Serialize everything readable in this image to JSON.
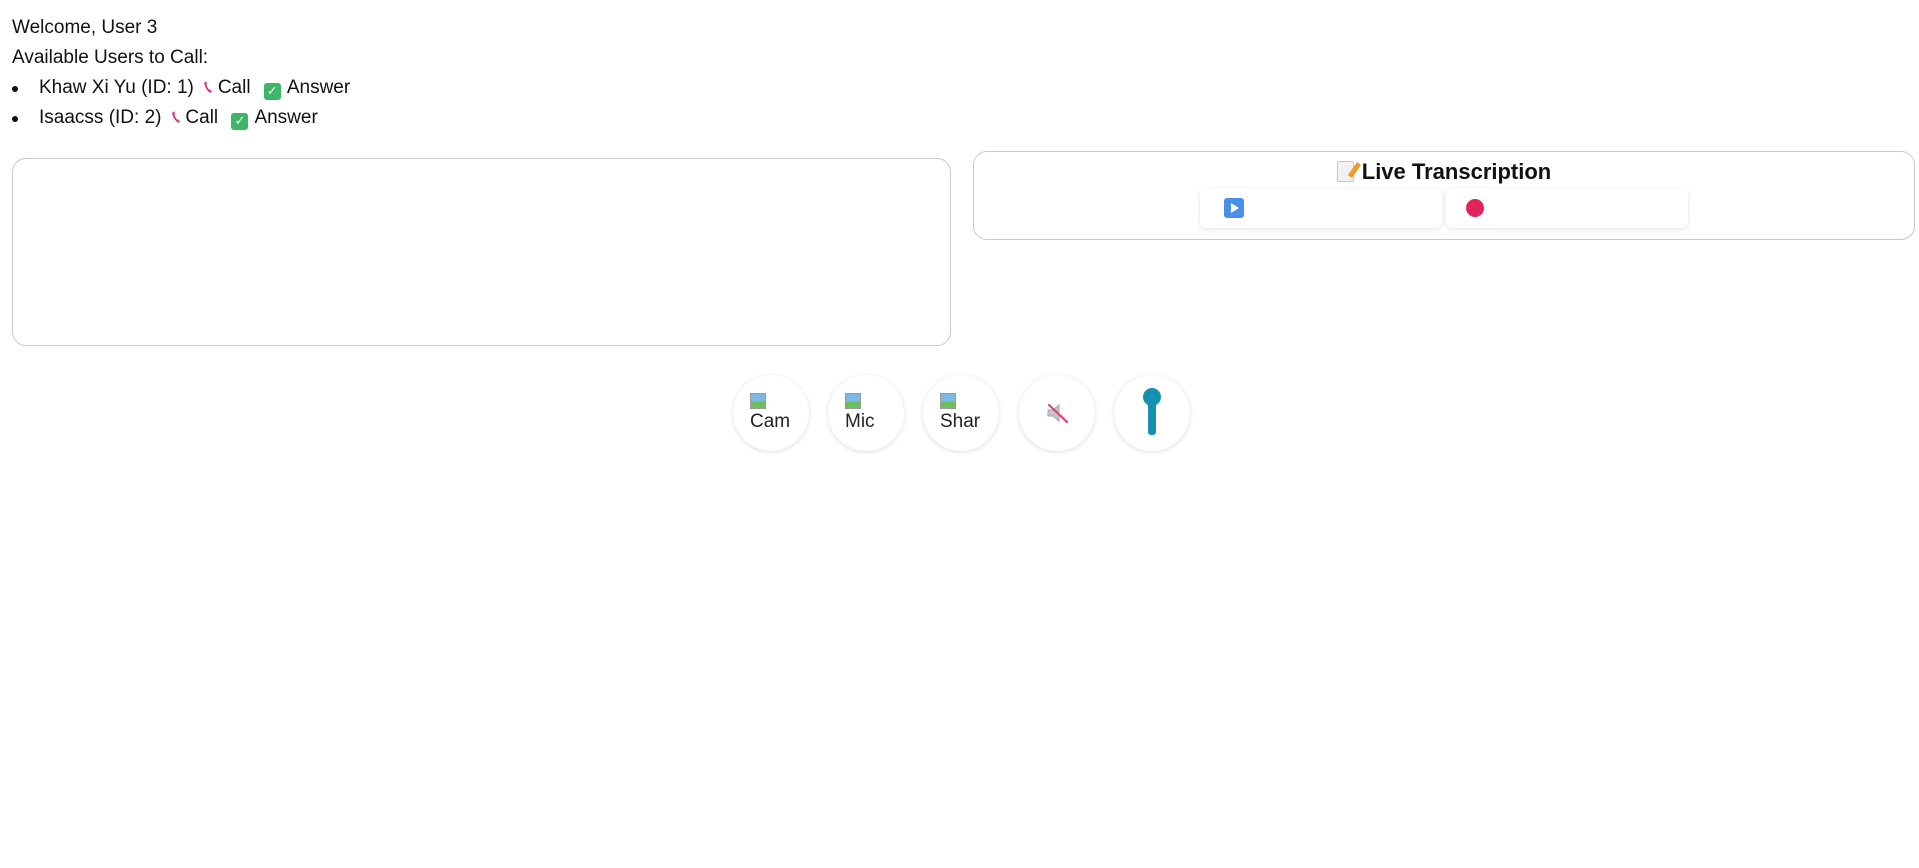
{
  "header": {
    "welcome": "Welcome, User 3",
    "available_label": "Available Users to Call:"
  },
  "users": [
    {
      "name": "Khaw Xi Yu (ID: 1)",
      "call_label": "Call",
      "answer_label": "Answer"
    },
    {
      "name": "Isaacss (ID: 2)",
      "call_label": "Call",
      "answer_label": "Answer"
    }
  ],
  "transcription": {
    "title": "Live Transcription",
    "title_icon": "memo-icon",
    "start_icon": "play-icon",
    "stop_icon": "record-icon"
  },
  "controls": {
    "camera_alt": "Cam",
    "mic_alt": "Mic",
    "share_alt": "Shar",
    "mute_icon": "speaker-muted-icon",
    "end_icon": "end-call-icon"
  },
  "colors": {
    "accent_phone": "#d62f82",
    "answer_check": "#3fb56a",
    "play": "#4a8fe7",
    "record": "#e3245a",
    "end_call": "#1692b0"
  }
}
